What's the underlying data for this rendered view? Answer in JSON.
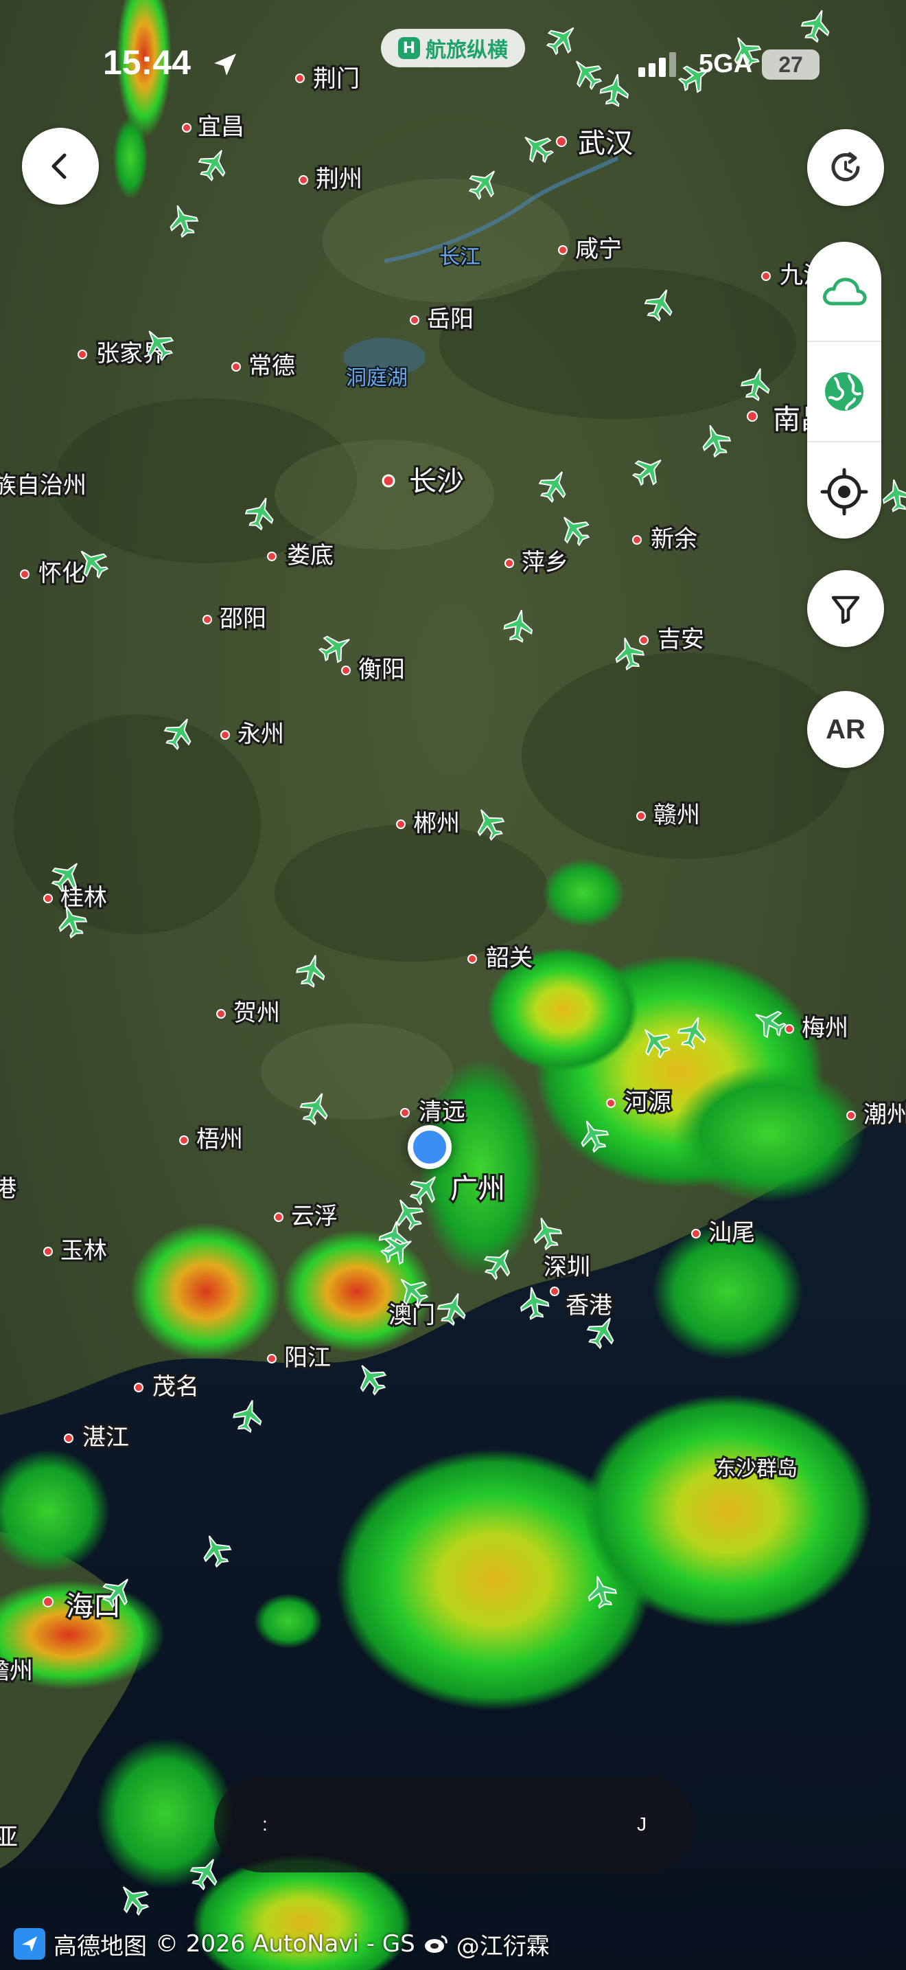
{
  "status_bar": {
    "time": "15:44",
    "network": "5GA",
    "battery": "27",
    "brand": "航旅纵横"
  },
  "controls": {
    "back": "back",
    "refresh": "refresh",
    "weather": "weather-layer",
    "globe": "globe",
    "locate": "locate",
    "filter": "filter",
    "ar_label": "AR"
  },
  "bottom_bar": {
    "left": ":",
    "right": "J"
  },
  "attribution": {
    "provider": "高德地图",
    "copyright": "© 2026 AutoNavi - GS",
    "weibo": "@江衍霖"
  },
  "map": {
    "cities": [
      {
        "name": "荆门"
      },
      {
        "name": "宜昌"
      },
      {
        "name": "荆州"
      },
      {
        "name": "武汉"
      },
      {
        "name": "咸宁"
      },
      {
        "name": "九江"
      },
      {
        "name": "岳阳"
      },
      {
        "name": "常德"
      },
      {
        "name": "张家界"
      },
      {
        "name": "长沙"
      },
      {
        "name": "南昌"
      },
      {
        "name": "娄底"
      },
      {
        "name": "萍乡"
      },
      {
        "name": "新余"
      },
      {
        "name": "怀化"
      },
      {
        "name": "邵阳"
      },
      {
        "name": "衡阳"
      },
      {
        "name": "吉安"
      },
      {
        "name": "永州"
      },
      {
        "name": "郴州"
      },
      {
        "name": "赣州"
      },
      {
        "name": "桂林"
      },
      {
        "name": "韶关"
      },
      {
        "name": "贺州"
      },
      {
        "name": "梅州"
      },
      {
        "name": "清远"
      },
      {
        "name": "河源"
      },
      {
        "name": "潮州"
      },
      {
        "name": "梧州"
      },
      {
        "name": "广州"
      },
      {
        "name": "云浮"
      },
      {
        "name": "汕尾"
      },
      {
        "name": "玉林"
      },
      {
        "name": "深圳"
      },
      {
        "name": "香港"
      },
      {
        "name": "澳门"
      },
      {
        "name": "阳江"
      },
      {
        "name": "茂名"
      },
      {
        "name": "湛江"
      },
      {
        "name": "海口"
      },
      {
        "name": "宜昌"
      }
    ],
    "water_labels": [
      "长江",
      "洞庭湖"
    ],
    "region_labels": [
      "东沙群岛",
      "族自治州",
      "家"
    ],
    "partial_labels": [
      "族自治州",
      "港",
      "儋州",
      "亚"
    ]
  }
}
